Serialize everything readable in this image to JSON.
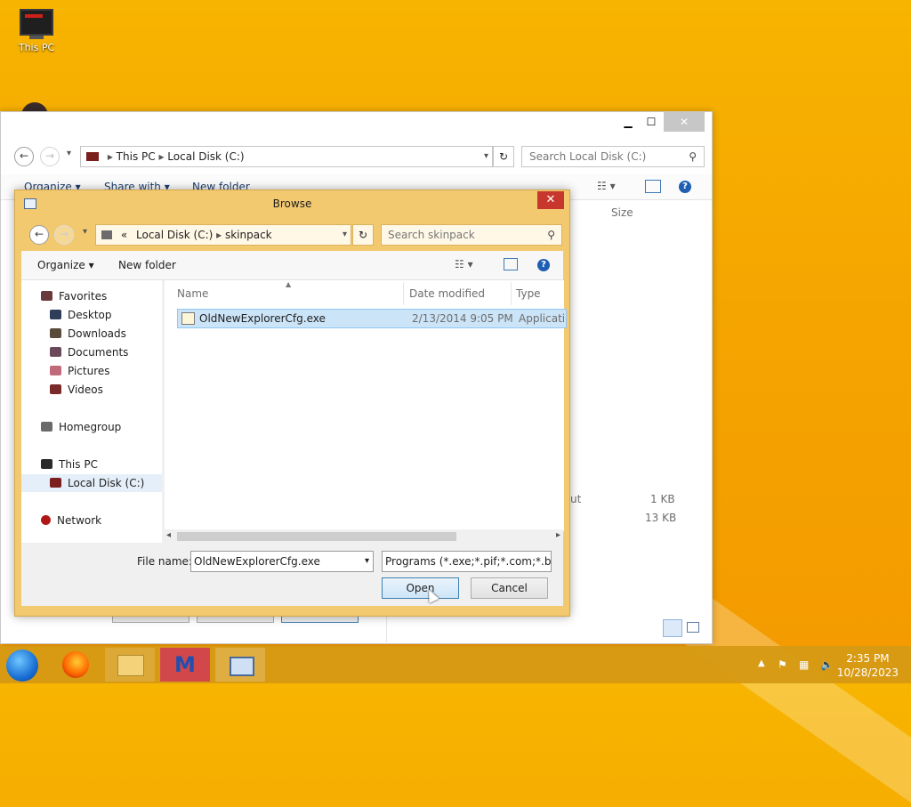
{
  "desktop": {
    "this_pc_label": "This PC"
  },
  "explorer": {
    "minimize_label": "▁",
    "maximize_label": "☐",
    "close_label": "✕",
    "back_label": "←",
    "forward_label": "→",
    "history_label": "▾",
    "breadcrumb": [
      "This PC",
      "Local Disk (C:)"
    ],
    "refresh_label": "↻",
    "search_placeholder": "Search Local Disk (C:)",
    "commands": {
      "organize": "Organize ▾",
      "share_with": "Share with ▾",
      "new_folder": "New folder"
    },
    "column_size": "Size",
    "rows": [
      {
        "name_fragment": "ut",
        "size": "1 KB"
      },
      {
        "name_fragment": "",
        "size": "13 KB"
      }
    ]
  },
  "dialog": {
    "title": "Browse",
    "close_label": "✕",
    "back_label": "←",
    "forward_label": "→",
    "history_label": "▾",
    "breadcrumb": [
      "«",
      "Local Disk (C:)",
      "skinpack"
    ],
    "refresh_label": "↻",
    "search_placeholder": "Search skinpack",
    "organize_label": "Organize ▾",
    "new_folder_label": "New folder",
    "tree": {
      "favorites": "Favorites",
      "desktop": "Desktop",
      "downloads": "Downloads",
      "documents": "Documents",
      "pictures": "Pictures",
      "videos": "Videos",
      "homegroup": "Homegroup",
      "this_pc": "This PC",
      "local_disk": "Local Disk (C:)",
      "network": "Network"
    },
    "columns": {
      "name": "Name",
      "date_modified": "Date modified",
      "type": "Type"
    },
    "files": [
      {
        "name": "OldNewExplorerCfg.exe",
        "date": "2/13/2014 9:05 PM",
        "type": "Application"
      }
    ],
    "file_name_label": "File name:",
    "file_name_value": "OldNewExplorerCfg.exe",
    "file_type_value": "Programs (*.exe;*.pif;*.com;*.ba",
    "open_label": "Open",
    "cancel_label": "Cancel"
  },
  "taskbar": {
    "time": "2:35 PM",
    "date": "10/28/2023"
  },
  "colors": {
    "desktop_bg": "#f5a500",
    "dialog_frame": "#f3c970",
    "close_red": "#c8372d",
    "selection": "#cce4f7"
  }
}
